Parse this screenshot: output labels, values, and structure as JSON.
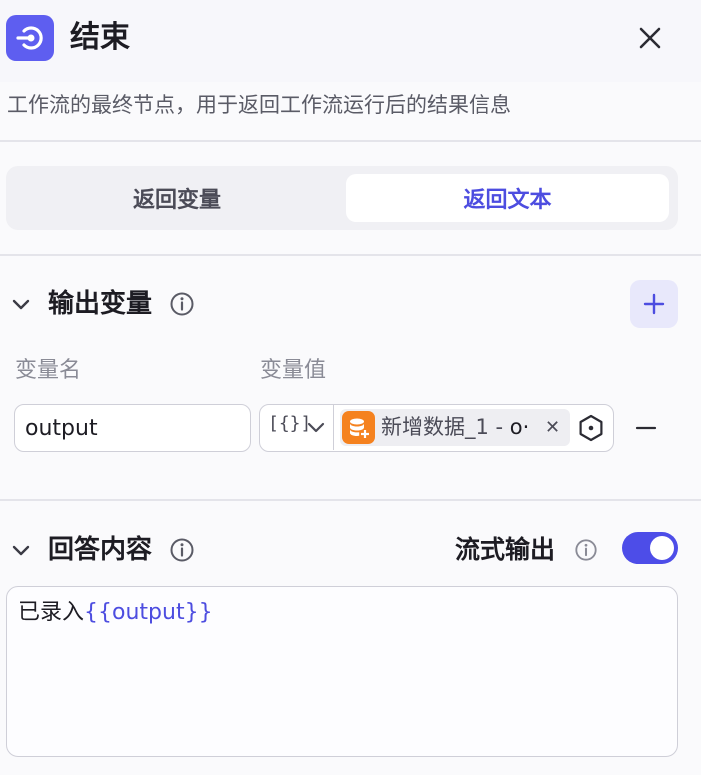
{
  "header": {
    "title": "结束",
    "description": "工作流的最终节点，用于返回工作流运行后的结果信息",
    "accent": "#5e5ef0"
  },
  "tabs": [
    {
      "label": "返回变量",
      "active": false
    },
    {
      "label": "返回文本",
      "active": true
    }
  ],
  "output_section": {
    "title": "输出变量",
    "col_name": "变量名",
    "col_value": "变量值",
    "rows": [
      {
        "name": "output",
        "type_glyph": "[{}]",
        "ref_label": "新增数据_1 - ",
        "ref_field": "o·",
        "remove_glyph": "−"
      }
    ]
  },
  "answer_section": {
    "title": "回答内容",
    "stream_label": "流式输出",
    "stream_enabled": true,
    "content_prefix": "已录入",
    "content_var": "{{output}}"
  },
  "icons": {
    "node": "end-node-icon",
    "close": "close-icon",
    "add": "plus-icon",
    "remove": "minus-icon",
    "ref": "database-icon"
  }
}
